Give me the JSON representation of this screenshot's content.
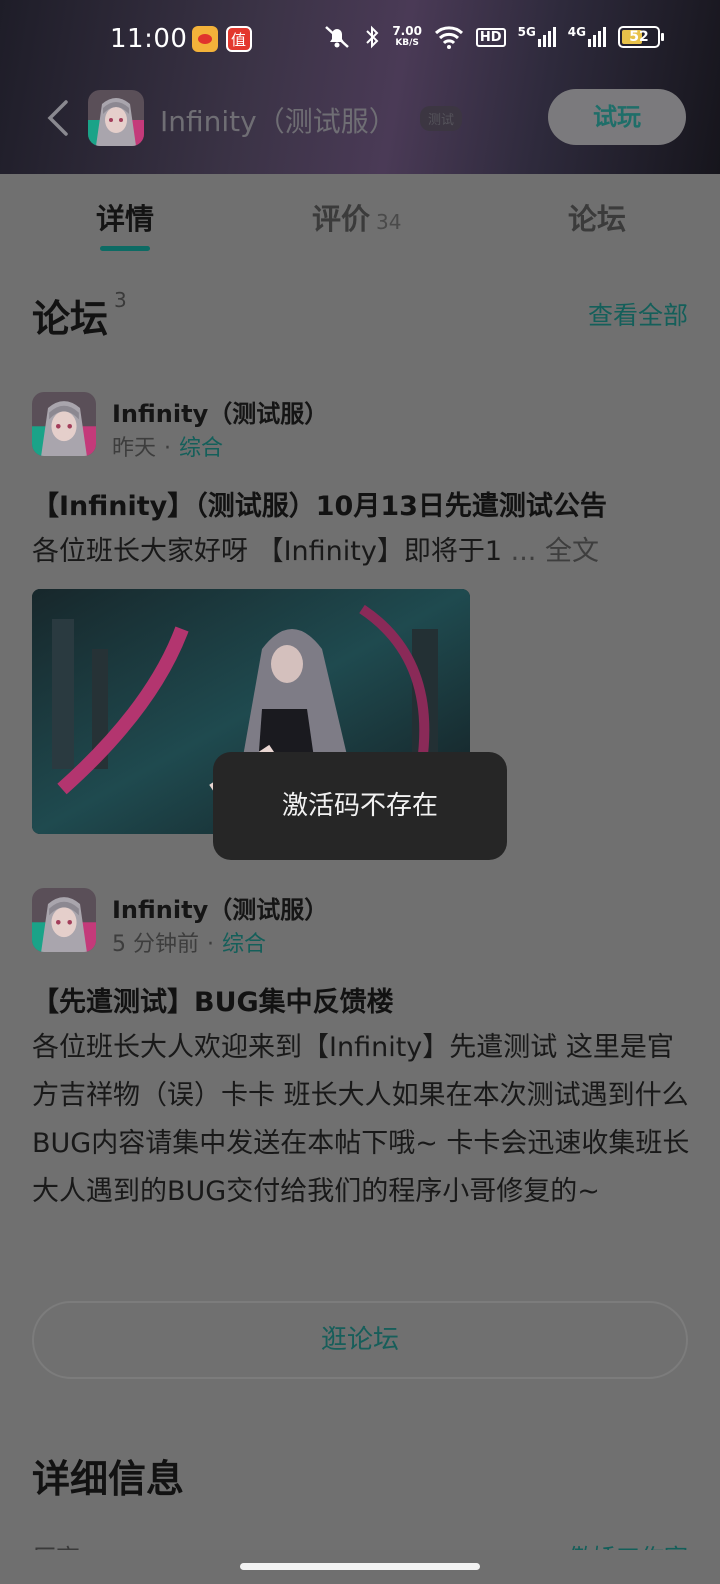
{
  "status_bar": {
    "time": "11:00",
    "apps": [
      "weibo-icon",
      "zhidemai-icon"
    ],
    "net_speed_value": "7.00",
    "net_speed_unit": "KB/S",
    "hd": "HD",
    "sim1": "5G",
    "sim2": "4G",
    "battery": "52"
  },
  "nav": {
    "title": "Infinity（测试服）",
    "tag": "测试",
    "try_label": "试玩"
  },
  "tabs": [
    {
      "label": "详情",
      "count": ""
    },
    {
      "label": "评价",
      "count": "34"
    },
    {
      "label": "论坛",
      "count": ""
    }
  ],
  "forum": {
    "title": "论坛",
    "count": "3",
    "see_all": "查看全部",
    "posts": [
      {
        "author": "Infinity（测试服）",
        "time": "昨天",
        "dot": "·",
        "category": "综合",
        "title": "【Infinity】（测试服）10月13日先遣测试公告",
        "excerpt": "各位班长大家好呀 【Infinity】即将于1",
        "more": "... 全文"
      },
      {
        "author": "Infinity（测试服）",
        "time": "5 分钟前",
        "dot": "·",
        "category": "综合",
        "title": "【先遣测试】BUG集中反馈楼",
        "body": "各位班长大人欢迎来到【Infinity】先遣测试 这里是官方吉祥物（误）卡卡 班长大人如果在本次测试遇到什么BUG内容请集中发送在本帖下哦~ 卡卡会迅速收集班长大人遇到的BUG交付给我们的程序小哥修复的~"
      }
    ],
    "browse_label": "逛论坛"
  },
  "toast": "激活码不存在",
  "details": {
    "title": "详细信息",
    "label": "厂商",
    "value": "傲娇工作室"
  },
  "colors": {
    "accent": "#145f5a",
    "overlay": "#707070",
    "toast_bg": "#262626"
  }
}
